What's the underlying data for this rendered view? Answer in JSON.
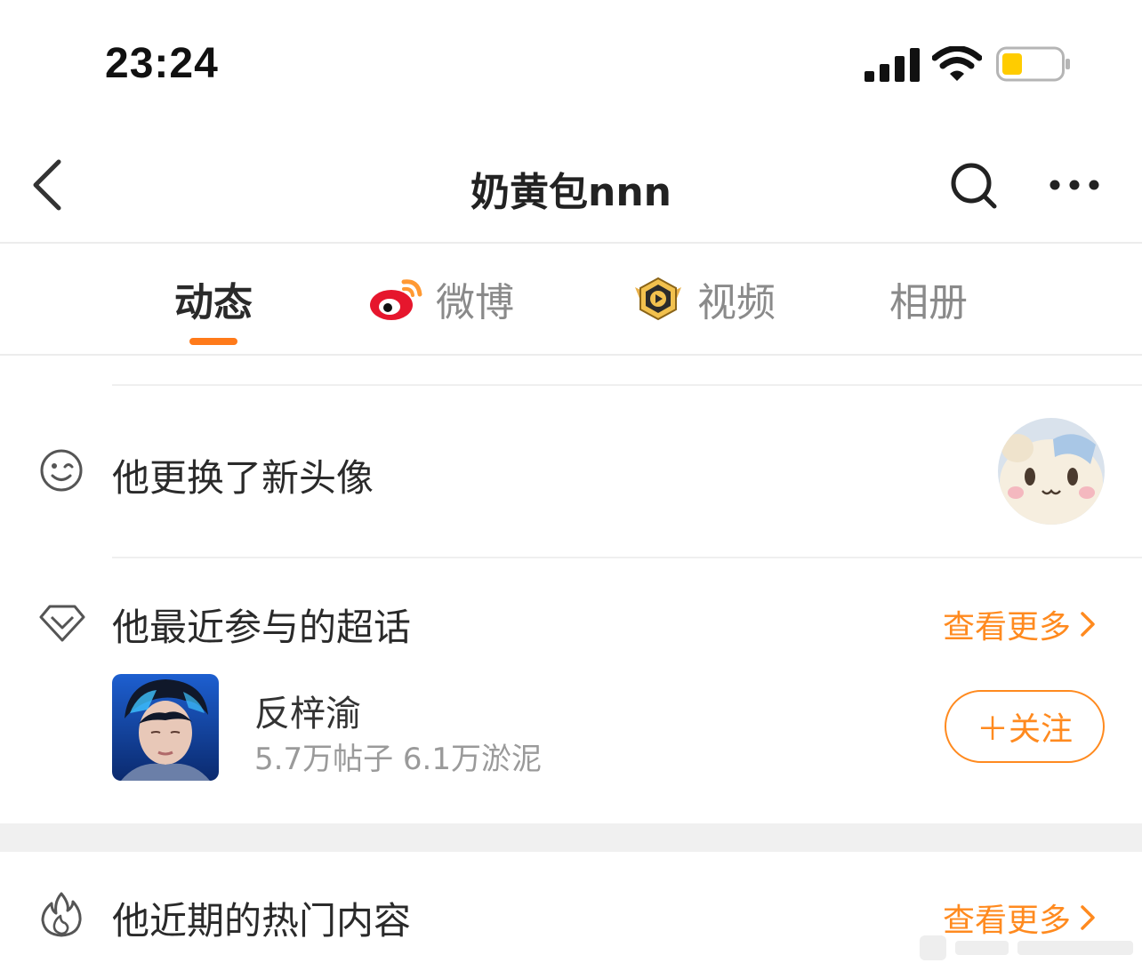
{
  "status_bar": {
    "time": "23:24",
    "signal_icon": "cellular-signal-icon",
    "wifi_icon": "wifi-icon",
    "battery_icon": "battery-icon",
    "battery_color": "#ffcc00"
  },
  "header": {
    "title": "奶黄包nnn",
    "back_icon": "chevron-left-icon",
    "search_icon": "search-icon",
    "more_icon": "ellipsis-icon"
  },
  "tabs": [
    {
      "label": "动态",
      "active": true
    },
    {
      "label": "微博",
      "icon": "weibo-logo-icon"
    },
    {
      "label": "视频",
      "icon": "video-badge-icon"
    },
    {
      "label": "相册"
    }
  ],
  "accent_color": "#ff8a1f",
  "activity": {
    "avatar_change_text": "他更换了新头像",
    "icon": "wink-face-icon"
  },
  "super_topics": {
    "title": "他最近参与的超话",
    "icon": "diamond-icon",
    "see_more": "查看更多",
    "item": {
      "name": "反梓渝",
      "stats": "5.7万帖子 6.1万淤泥",
      "follow_label": "＋关注"
    }
  },
  "hot_content": {
    "title": "他近期的热门内容",
    "icon": "flame-icon",
    "see_more": "查看更多"
  }
}
